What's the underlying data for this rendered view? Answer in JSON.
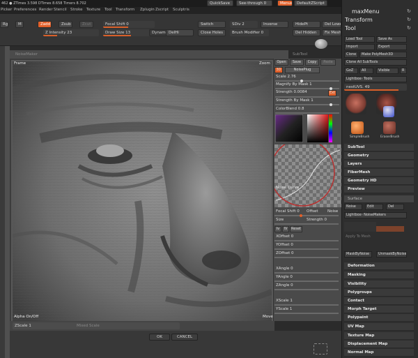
{
  "topbar": {
    "stats": "462 ● ZTimes 3.598  DTimes 8.658  Timers 8.702",
    "quicksave": "QuickSave",
    "seethrough": "See-through  0",
    "menus_label": "Menus",
    "script": "DefaultZScript"
  },
  "menubar": [
    "Picker",
    "Preferences",
    "Render",
    "Stencil",
    "Stroke",
    "Texture",
    "Tool",
    "Transform",
    "Zplugin",
    "Zscript",
    "Sculptris"
  ],
  "toolbar": {
    "rgb": "Rgb",
    "m": "M",
    "zadd": "Zadd",
    "zsub": "Zsub",
    "zcut": "Zcut",
    "focal_shift": "Focal Shift 0",
    "draw_size": "Draw Size 13",
    "switch": "Switch",
    "sdiv": "SDiv 2",
    "inverse": "Inverse",
    "hidept": "HidePt",
    "del_lower": "Del Lower",
    "z_intensity": "Z Intensity 23",
    "dynamic": "Dynamic",
    "delhi": "DelHi",
    "close_holes": "Close Holes",
    "brush_modifier": "Brush Modifier 0",
    "del_hidden": "Del Hidden",
    "fix_mesh": "Fix Mesh"
  },
  "canvas": {
    "header": "NoiseMaker",
    "subtool_header": "SubTool",
    "frame_label": "Frame",
    "zoom_label": "Zoom",
    "alpha_label": "Alpha On/Off",
    "move_label": "Move",
    "zscale": "ZScale 1",
    "mixed_scale": "Mixed Scale"
  },
  "brushpanel": {
    "open": "Open",
    "save": "Save",
    "copy": "Copy",
    "paste": "Paste",
    "threed": "3D",
    "noiseplug": "NoisePlug",
    "scale": "Scale 2.76",
    "mag_by_mask": "Magnify By Mask 1",
    "strength": "Strength 0.0084",
    "ext": "Ext",
    "strength_by_mask": "Strength By Mask 1",
    "colorblend": "ColorBlend 0.8",
    "noise_curve": "Noise Curve",
    "focal_shift": "Focal Shift 0",
    "offset": "Offset",
    "noise": "Noise",
    "size": "Size",
    "strength2": "Strength 0",
    "tabs": [
      "Iv",
      "IV",
      "Reset"
    ],
    "xoffset": "XOffset 0",
    "yoffset": "YOffset 0",
    "zoffset": "ZOffset 0",
    "xangle": "XAngle 0",
    "yangle": "YAngle 0",
    "zangle": "ZAngle 0",
    "xscale": "XScale 1",
    "yscale": "YScale 1"
  },
  "dialog": {
    "ok": "OK",
    "cancel": "CANCEL"
  },
  "rightpanel": {
    "maxmenu": "maxMenu",
    "transform": "Transform",
    "tool": "Tool",
    "load_tool": "Load Tool",
    "save_as": "Save As",
    "import": "Import",
    "export": "Export",
    "clone": "Clone",
    "make_polymesh": "Make PolyMesh3D",
    "clone_all": "Clone All SubTools",
    "goz": "GoZ",
    "all": "All",
    "visible": "Visible",
    "r": "R",
    "lightbox_tools": "Lightbox› Tools",
    "nesttool": "nestUVS. 49",
    "thumbs": [
      "SimpleBrush",
      "EraserBrush"
    ],
    "items": [
      "SubTool",
      "Geometry",
      "Layers",
      "FiberMesh",
      "Geometry HD",
      "Preview"
    ],
    "surface": "Surface",
    "noise_btn": "Noise",
    "edit_btn": "Edit",
    "del_btn": "Del",
    "lightbox_noise": "Lightbox› NoiseMakers",
    "apply_to_mesh": "Apply To Mesh",
    "mask_by_noise": "MaskByNoise",
    "unmask_by_noise": "UnmaskByNoise",
    "items2": [
      "Deformation",
      "Masking",
      "Visibility",
      "Polygroups",
      "Contact",
      "Morph Target",
      "Polypaint",
      "UV Map",
      "Texture Map",
      "Displacement Map",
      "Normal Map"
    ]
  },
  "colors": {
    "accent": "#e2602a",
    "panel": "#4a4a4a",
    "dark": "#2e2e2e"
  }
}
